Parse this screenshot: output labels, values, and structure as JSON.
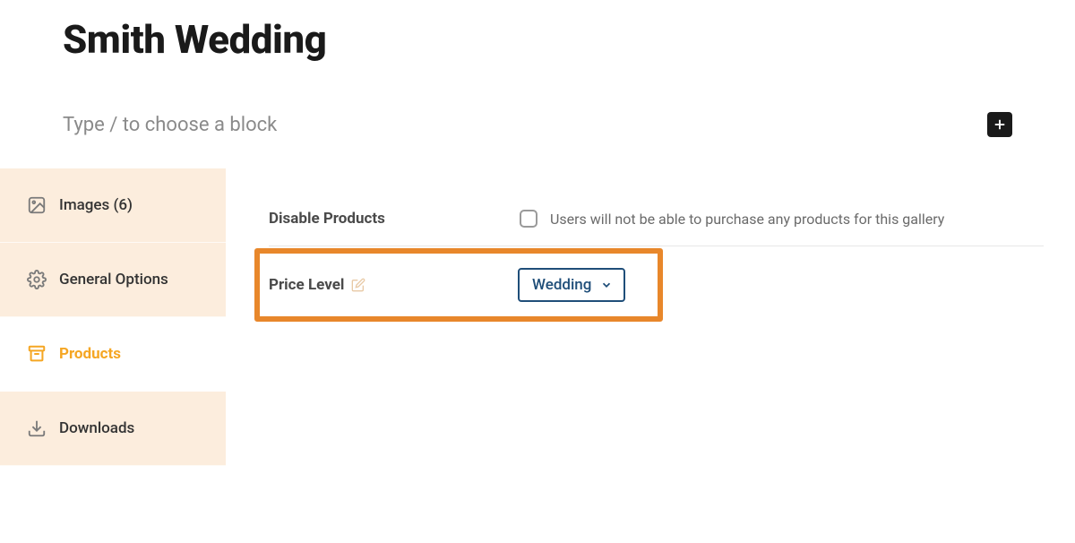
{
  "header": {
    "title": "Smith Wedding",
    "block_placeholder": "Type / to choose a block"
  },
  "sidebar": {
    "items": [
      {
        "label": "Images (6)",
        "icon": "image",
        "active": false
      },
      {
        "label": "General Options",
        "icon": "gear",
        "active": false
      },
      {
        "label": "Products",
        "icon": "archive",
        "active": true
      },
      {
        "label": "Downloads",
        "icon": "download",
        "active": false
      }
    ]
  },
  "settings": {
    "disable_products": {
      "label": "Disable Products",
      "helper": "Users will not be able to purchase any products for this gallery",
      "checked": false
    },
    "price_level": {
      "label": "Price Level",
      "selected": "Wedding"
    }
  }
}
